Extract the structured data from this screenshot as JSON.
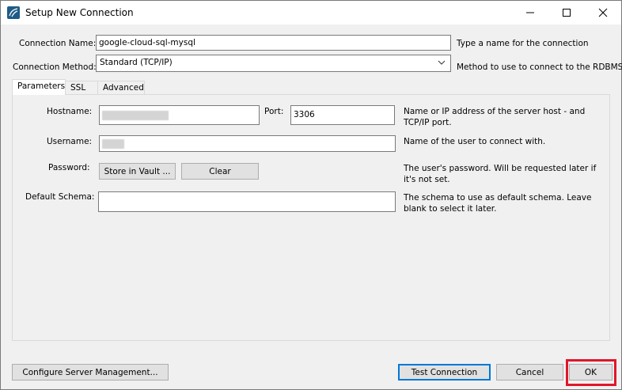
{
  "window": {
    "title": "Setup New Connection",
    "controls": [
      "minimize",
      "maximize",
      "close"
    ]
  },
  "connection_name": {
    "label": "Connection Name:",
    "value": "google-cloud-sql-mysql",
    "hint": "Type a name for the connection"
  },
  "connection_method": {
    "label": "Connection Method:",
    "selected": "Standard (TCP/IP)",
    "hint": "Method to use to connect to the RDBMS"
  },
  "tabs": [
    {
      "label": "Parameters",
      "active": true
    },
    {
      "label": "SSL",
      "active": false
    },
    {
      "label": "Advanced",
      "active": false
    }
  ],
  "parameters": {
    "hostname_label": "Hostname:",
    "hostname_value": "",
    "port_label": "Port:",
    "port_value": "3306",
    "hostname_hint": "Name or IP address of the server host - and TCP/IP port.",
    "username_label": "Username:",
    "username_value": "",
    "username_hint": "Name of the user to connect with.",
    "password_label": "Password:",
    "store_vault_label": "Store in Vault ...",
    "clear_label": "Clear",
    "password_hint": "The user's password. Will be requested later if it's not set.",
    "schema_label": "Default Schema:",
    "schema_value": "",
    "schema_hint": "The schema to use as default schema. Leave blank to select it later."
  },
  "footer": {
    "configure_label": "Configure Server Management...",
    "test_label": "Test Connection",
    "cancel_label": "Cancel",
    "ok_label": "OK"
  },
  "colors": {
    "highlight_box": "#e0162b",
    "focus_border": "#0078d7"
  }
}
